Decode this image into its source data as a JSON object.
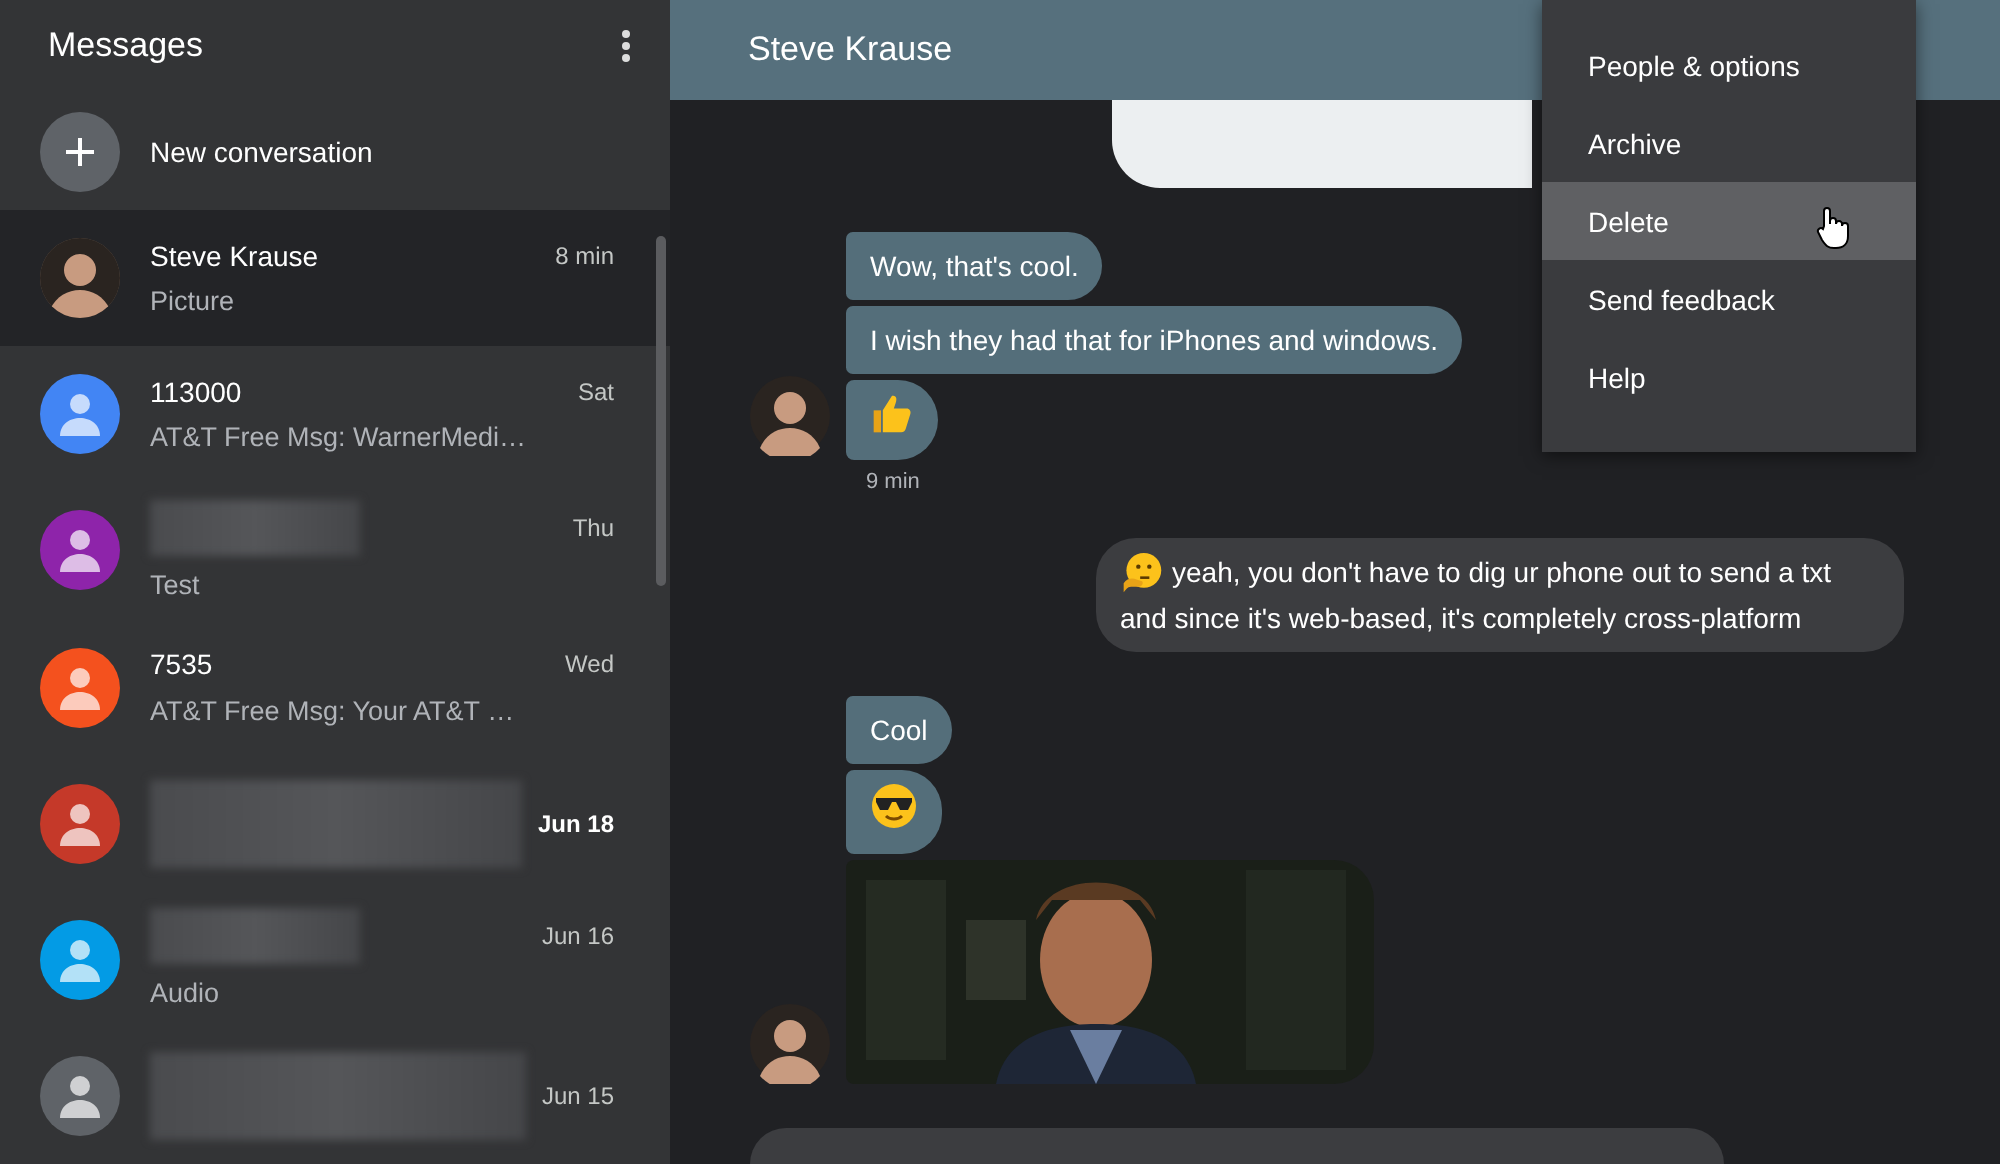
{
  "sidebar": {
    "title": "Messages",
    "new_conversation": "New conversation",
    "conversations": [
      {
        "color": "#5a4a3e",
        "name": "Steve Krause",
        "preview": "Picture",
        "time": "8 min",
        "selected": true,
        "unread": false
      },
      {
        "kind": "contact",
        "color": "#4285f4",
        "name": "113000",
        "preview": "AT&T Free Msg: WarnerMedi…",
        "time": "Sat",
        "selected": false,
        "unread": false
      },
      {
        "kind": "contact",
        "color": "#8e24aa",
        "preview": "Test",
        "time": "Thu",
        "selected": false,
        "unread": false
      },
      {
        "kind": "contact",
        "color": "#f4511e",
        "name": "7535",
        "preview": "AT&T Free Msg: Your AT&T …",
        "time": "Wed",
        "selected": false,
        "unread": false
      },
      {
        "kind": "contact",
        "color": "#c53929",
        "time": "Jun 18",
        "selected": false,
        "unread": true
      },
      {
        "kind": "contact",
        "color": "#039be5",
        "preview": "Audio",
        "time": "Jun 16",
        "selected": false,
        "unread": false
      },
      {
        "kind": "contact",
        "color": "#5f6368",
        "time": "Jun 15",
        "selected": false,
        "unread": false
      }
    ]
  },
  "chat": {
    "title": "Steve Krause",
    "groups": [
      {
        "kind": "outgoing",
        "messages": [
          {
            "kind": "card"
          }
        ]
      },
      {
        "kind": "incoming",
        "time": "9 min",
        "messages": [
          {
            "kind": "text",
            "text": "Wow, that's cool."
          },
          {
            "kind": "text",
            "text": "I wish they had that for iPhones and windows."
          },
          {
            "kind": "thumbs-up"
          }
        ]
      },
      {
        "kind": "outgoing",
        "messages": [
          {
            "kind": "thinking-text",
            "text": "yeah, you don't have to dig ur phone out to send a txt and since it's web-based, it's completely cross-platform"
          }
        ]
      },
      {
        "kind": "incoming",
        "messages": [
          {
            "kind": "text",
            "text": "Cool"
          },
          {
            "kind": "sunglasses"
          },
          {
            "kind": "picture"
          }
        ]
      }
    ]
  },
  "menu": {
    "items": [
      {
        "label": "People & options",
        "selected": false
      },
      {
        "label": "Archive",
        "selected": false
      },
      {
        "label": "Delete",
        "selected": true
      },
      {
        "label": "Send feedback",
        "selected": false
      },
      {
        "label": "Help",
        "selected": false
      }
    ]
  }
}
